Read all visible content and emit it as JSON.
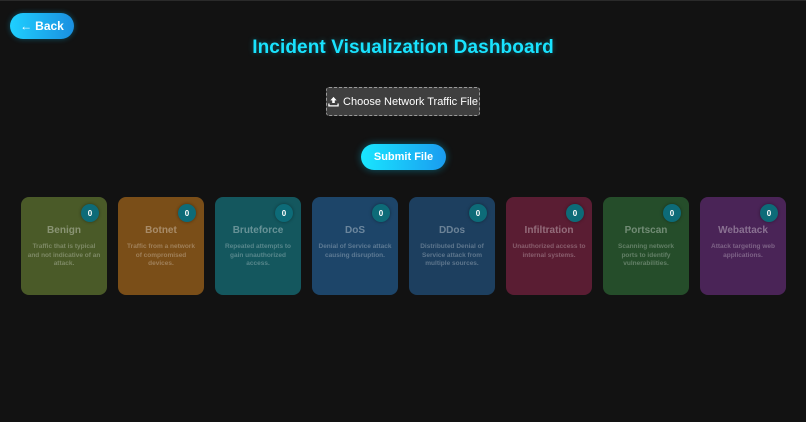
{
  "header": {
    "back_label": "Back",
    "back_arrow": "←",
    "title": "Incident Visualization Dashboard"
  },
  "upload": {
    "file_icon": "upload-icon",
    "file_label": "Choose Network Traffic File",
    "submit_label": "Submit File"
  },
  "cards": [
    {
      "name": "Benign",
      "count": "0",
      "description": "Traffic that is typical and not indicative of an attack.",
      "color": "#4a5a28"
    },
    {
      "name": "Botnet",
      "count": "0",
      "description": "Traffic from a network of compromised devices.",
      "color": "#7a4e18"
    },
    {
      "name": "Bruteforce",
      "count": "0",
      "description": "Repeated attempts to gain unauthorized access.",
      "color": "#14575e"
    },
    {
      "name": "DoS",
      "count": "0",
      "description": "Denial of Service attack causing disruption.",
      "color": "#1d4569"
    },
    {
      "name": "DDos",
      "count": "0",
      "description": "Distributed Denial of Service attack from multiple sources.",
      "color": "#1d3f5f"
    },
    {
      "name": "Infiltration",
      "count": "0",
      "description": "Unauthorized access to internal systems.",
      "color": "#5a1d33"
    },
    {
      "name": "Portscan",
      "count": "0",
      "description": "Scanning network ports to identify vulnerabilities.",
      "color": "#254d2a"
    },
    {
      "name": "Webattack",
      "count": "0",
      "description": "Attack targeting web applications.",
      "color": "#4a2457"
    }
  ],
  "colors": {
    "accent": "#19e3ff",
    "background": "#121212"
  }
}
